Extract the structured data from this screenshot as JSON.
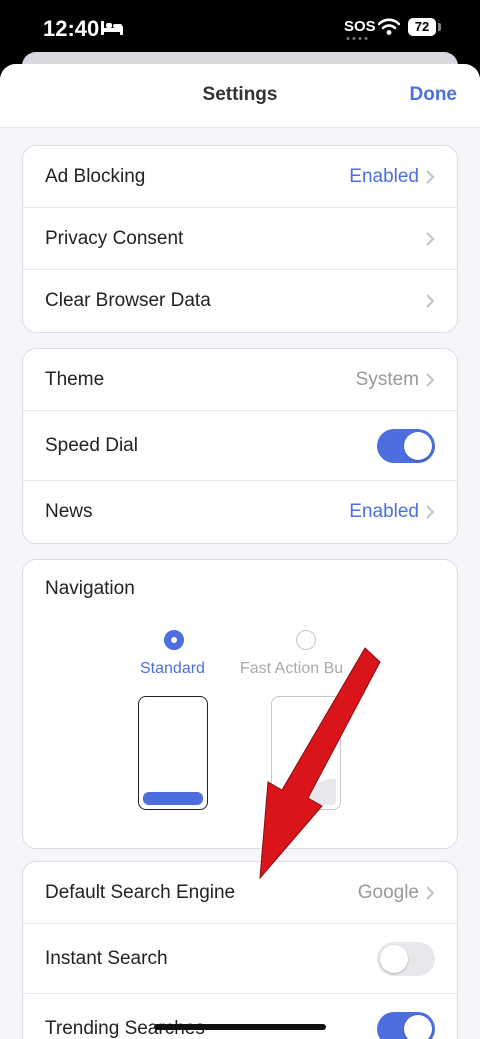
{
  "status_bar": {
    "time": "12:40",
    "sos": "SOS",
    "battery": "72",
    "icons": [
      "bed-icon",
      "wifi-icon",
      "battery-icon"
    ]
  },
  "header": {
    "title": "Settings",
    "done_label": "Done"
  },
  "group1": {
    "ad_blocking": {
      "label": "Ad Blocking",
      "value": "Enabled"
    },
    "privacy_consent": {
      "label": "Privacy Consent"
    },
    "clear_browser_data": {
      "label": "Clear Browser Data"
    }
  },
  "group2": {
    "theme": {
      "label": "Theme",
      "value": "System"
    },
    "speed_dial": {
      "label": "Speed Dial",
      "enabled": true
    },
    "news": {
      "label": "News",
      "value": "Enabled"
    }
  },
  "navigation": {
    "title": "Navigation",
    "options": [
      {
        "label": "Standard",
        "selected": true
      },
      {
        "label": "Fast Action Bu",
        "selected": false
      }
    ]
  },
  "group3": {
    "default_search_engine": {
      "label": "Default Search Engine",
      "value": "Google"
    },
    "instant_search": {
      "label": "Instant Search",
      "enabled": false
    },
    "trending_searches": {
      "label": "Trending Searches",
      "enabled": true
    }
  },
  "colors": {
    "accent": "#4d6fde",
    "annotation_arrow": "#d9141b"
  }
}
